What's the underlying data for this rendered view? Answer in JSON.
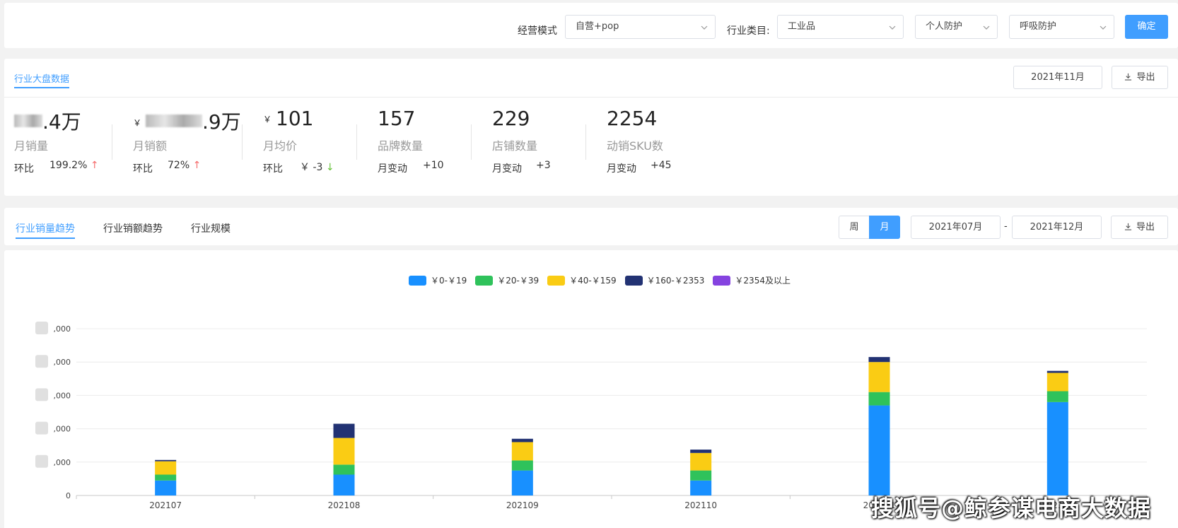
{
  "filters": {
    "mode_label": "经营模式",
    "mode_value": "自营+pop",
    "category_label": "行业类目:",
    "category_value": "工业品",
    "sub1_value": "个人防护",
    "sub2_value": "呼吸防护",
    "confirm_label": "确定"
  },
  "stats": {
    "tab_label": "行业大盘数据",
    "month_value": "2021年11月",
    "export_label": "导出",
    "items": [
      {
        "value": ".4万",
        "label": "月销量",
        "sub_label": "环比",
        "sub_value": "199.2%",
        "trend": "up"
      },
      {
        "value": ".9万",
        "label": "月销额",
        "sub_label": "环比",
        "sub_value": "72%",
        "trend": "up"
      },
      {
        "value": "101",
        "label": "月均价",
        "sub_label": "环比",
        "sub_value": "￥ -3",
        "trend": "down"
      },
      {
        "value": "157",
        "label": "品牌数量",
        "sub_label": "月变动",
        "sub_value": "+10"
      },
      {
        "value": "229",
        "label": "店铺数量",
        "sub_label": "月变动",
        "sub_value": "+3"
      },
      {
        "value": "2254",
        "label": "动销SKU数",
        "sub_label": "月变动",
        "sub_value": "+45"
      }
    ],
    "yen_symbol": "￥"
  },
  "trend": {
    "tabs": [
      "行业销量趋势",
      "行业销额趋势",
      "行业规模"
    ],
    "period_week": "周",
    "period_month": "月",
    "start_month": "2021年07月",
    "separator": "-",
    "end_month": "2021年12月",
    "export_label": "导出"
  },
  "chart_data": {
    "type": "bar",
    "stacked": true,
    "categories": [
      "202107",
      "202108",
      "202109",
      "202110",
      "202111",
      "202112"
    ],
    "series": [
      {
        "name": "￥0-￥19",
        "color": "#1890ff",
        "values": [
          9000,
          12500,
          15000,
          9000,
          54000,
          56000
        ]
      },
      {
        "name": "￥20-￥39",
        "color": "#2fc25b",
        "values": [
          3500,
          6000,
          6000,
          6000,
          8000,
          6500
        ]
      },
      {
        "name": "￥40-￥159",
        "color": "#facc14",
        "values": [
          8000,
          16000,
          11000,
          10500,
          18000,
          11000
        ]
      },
      {
        "name": "￥160-￥2353",
        "color": "#223273",
        "values": [
          800,
          8500,
          2000,
          2000,
          3000,
          1200
        ]
      },
      {
        "name": "￥2354及以上",
        "color": "#8543e0",
        "values": [
          0,
          0,
          0,
          0,
          0,
          0
        ]
      }
    ],
    "y_ticks": [
      ",000",
      ",000",
      ",000",
      ",000",
      ",000",
      "0"
    ],
    "ylim": [
      0,
      100000
    ],
    "grid": true,
    "legend_position": "top"
  },
  "watermark": "搜狐号@鲸参谋电商大数据",
  "colors": {
    "accent": "#409eff",
    "up": "#f56c6c",
    "down": "#67c23a"
  }
}
